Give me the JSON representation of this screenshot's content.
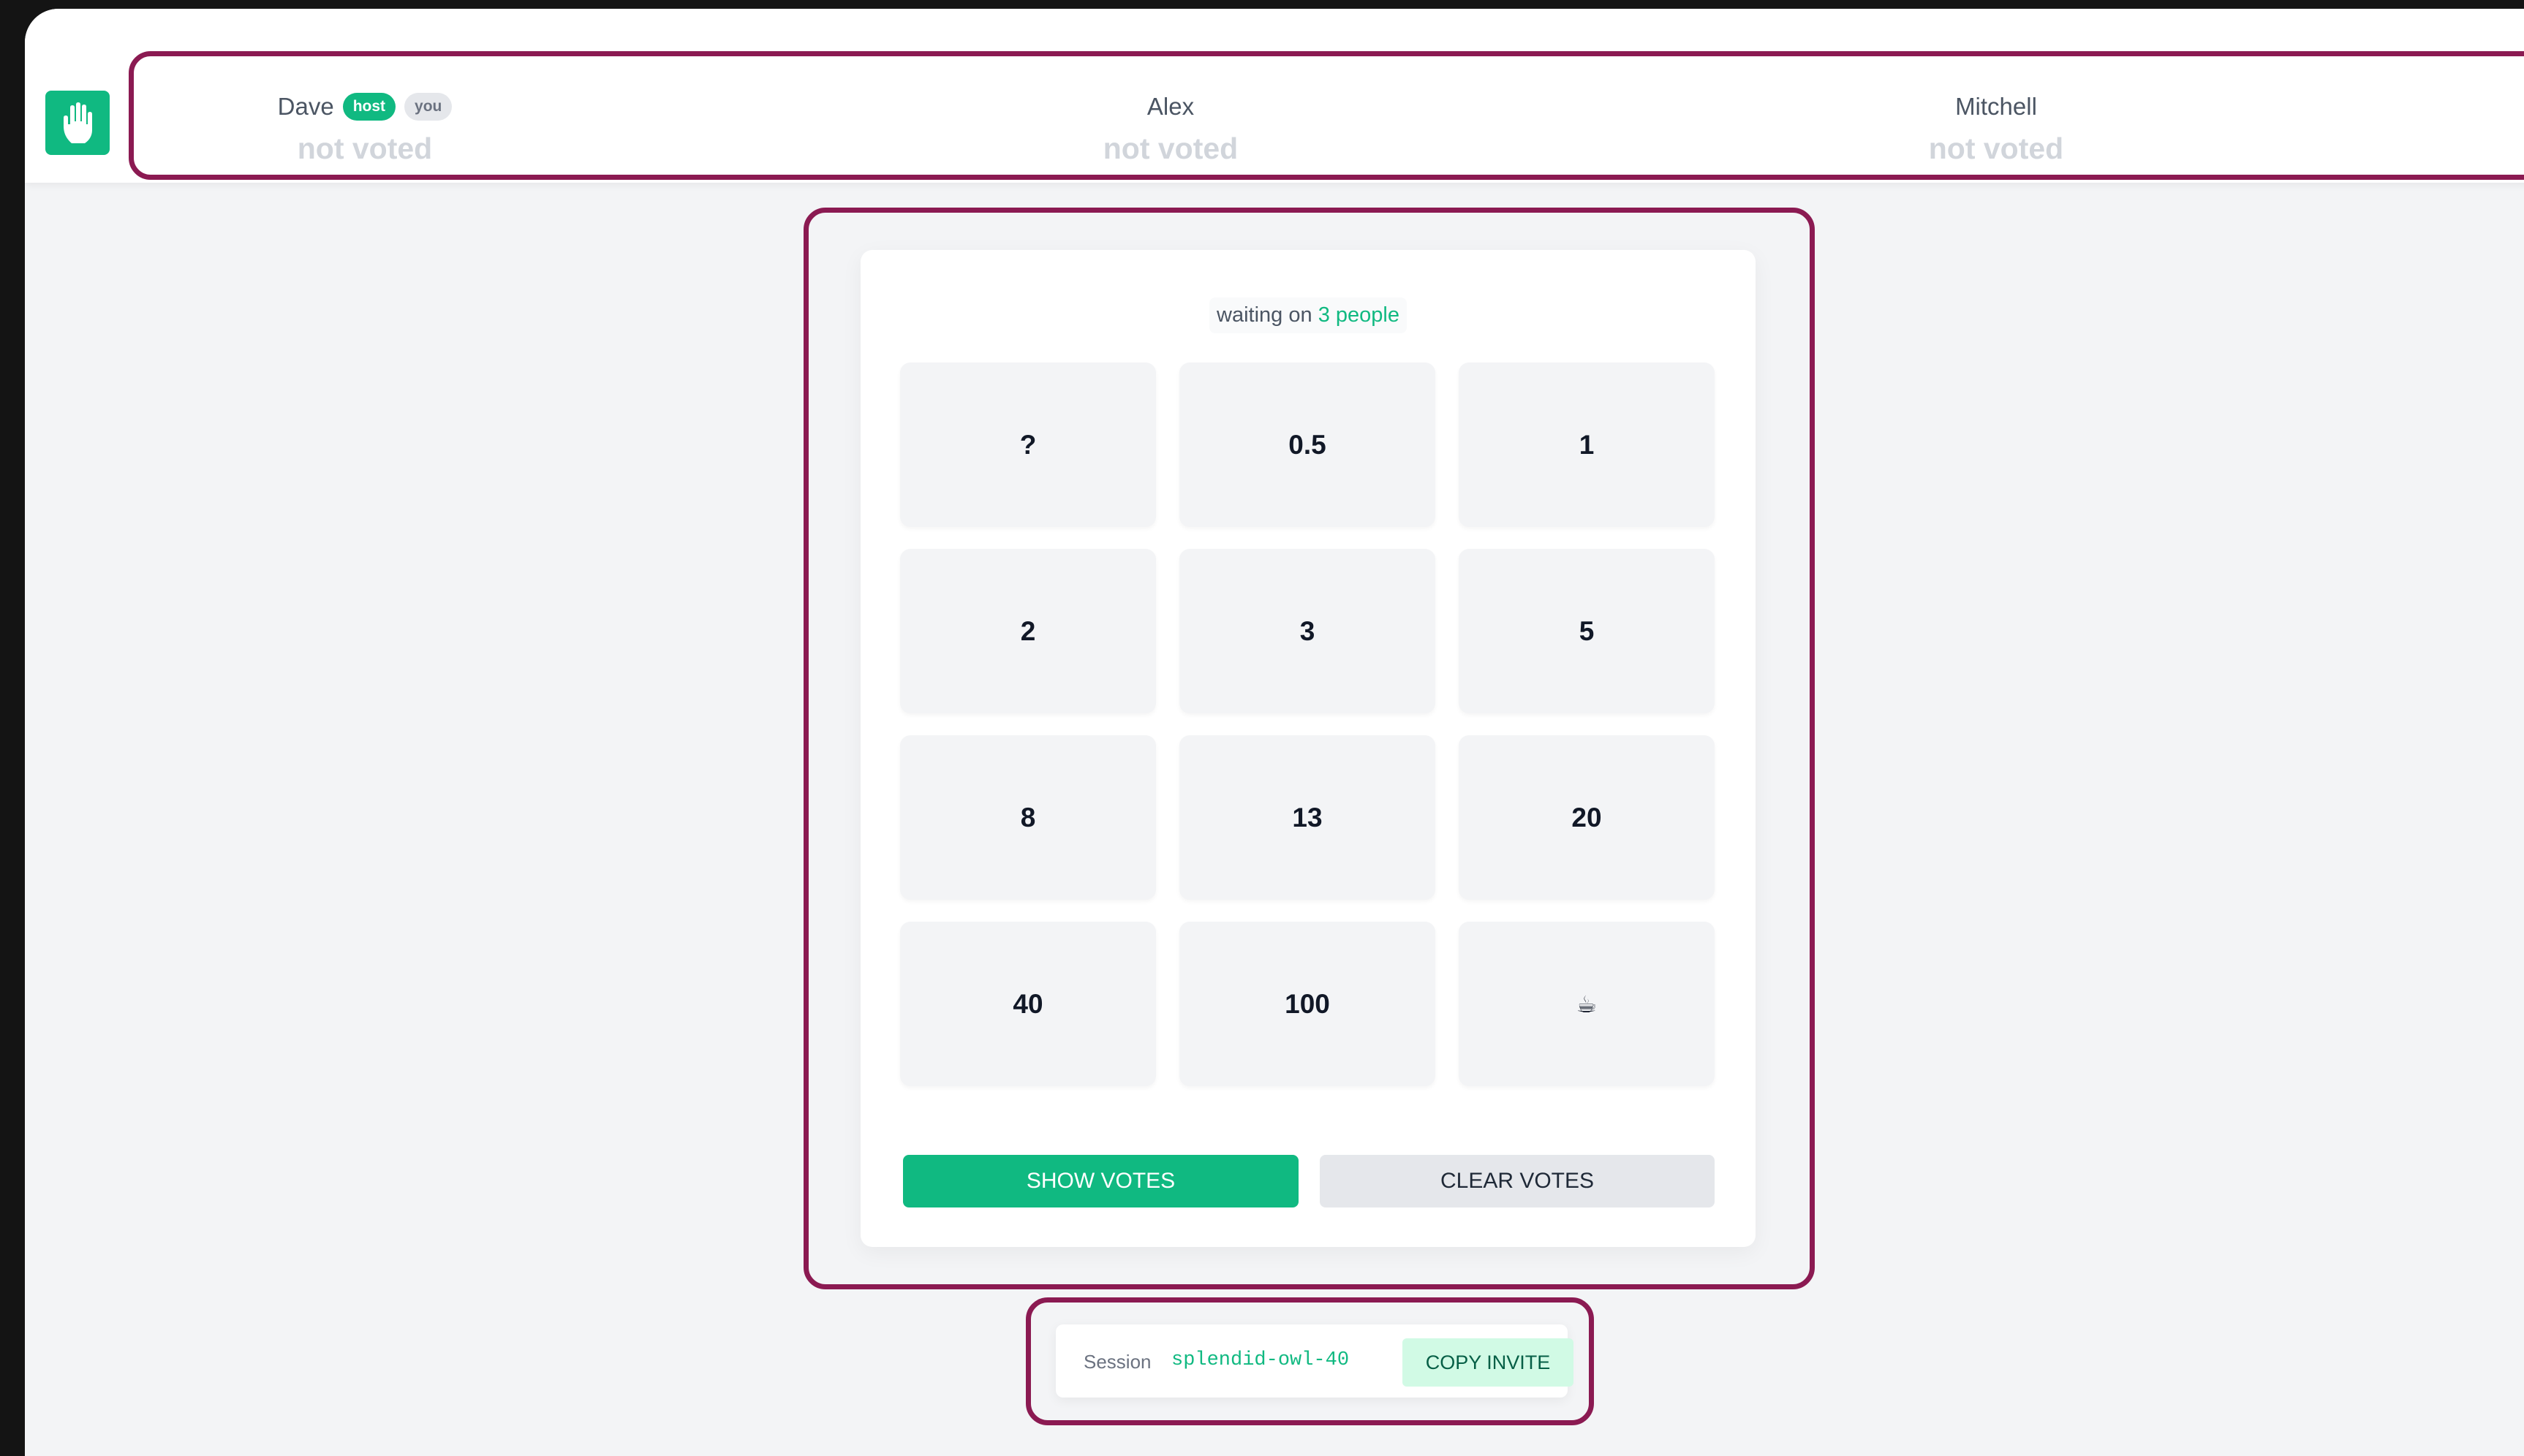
{
  "app": {
    "accent_color": "#10b981",
    "highlight_color": "#8b1a52",
    "logo_icon": "raised-hand-icon"
  },
  "participants": [
    {
      "name": "Dave",
      "badges": [
        "host",
        "you"
      ],
      "status": "not voted"
    },
    {
      "name": "Alex",
      "badges": [],
      "status": "not voted"
    },
    {
      "name": "Mitchell",
      "badges": [],
      "status": "not voted"
    }
  ],
  "voting": {
    "waiting_prefix": "waiting on",
    "waiting_count": "3 people",
    "cards": [
      "?",
      "0.5",
      "1",
      "2",
      "3",
      "5",
      "8",
      "13",
      "20",
      "40",
      "100",
      "coffee-cup-icon"
    ],
    "show_votes_label": "SHOW VOTES",
    "clear_votes_label": "CLEAR VOTES"
  },
  "session": {
    "label": "Session",
    "id": "splendid-owl-40",
    "copy_label": "COPY INVITE"
  }
}
